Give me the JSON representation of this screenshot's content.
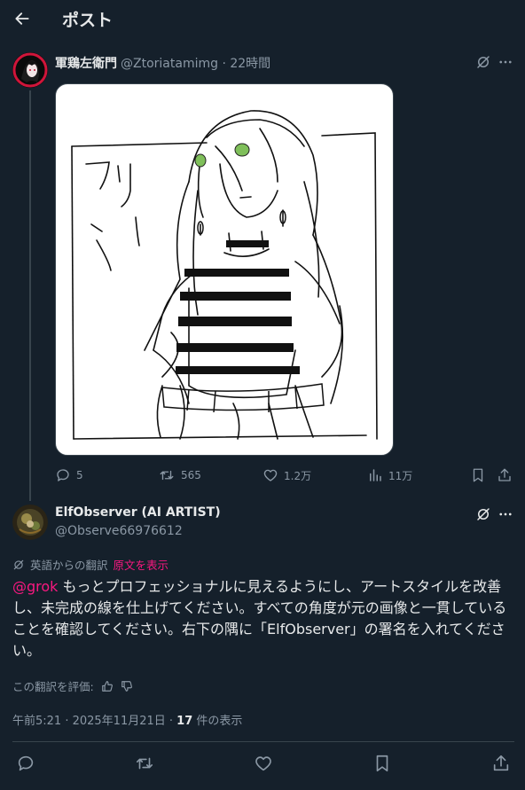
{
  "header": {
    "title": "ポスト",
    "back_icon": "arrow-left-icon"
  },
  "parent_tweet": {
    "author_name": "軍鶏左衛門",
    "author_handle": "@Ztoriatamimg · 22時間",
    "media_text": "フリーレン",
    "actions": {
      "replies": "5",
      "reposts": "565",
      "likes": "1.2万",
      "views": "11万"
    }
  },
  "reply_tweet": {
    "author_name": "ElfObserver (AI ARTIST)",
    "author_handle": "@Observe66976612",
    "translation_label": "英語からの翻訳",
    "show_original": "原文を表示",
    "mention": "@grok",
    "body": " もっとプロフェッショナルに見えるようにし、アートスタイルを改善し、未完成の線を仕上げてください。すべての角度が元の画像と一貫していることを確認してください。右下の隅に「ElfObserver」の署名を入れてください。",
    "rate_translation": "この翻訳を評価:",
    "timestamp": "午前5:21 · 2025年11月21日 · ",
    "view_count": "17",
    "view_label": " 件の表示"
  },
  "colors": {
    "background": "#15202b",
    "text_primary": "#e7e9ea",
    "text_secondary": "#8b98a5",
    "accent": "#f91880",
    "divider": "#38444d"
  }
}
